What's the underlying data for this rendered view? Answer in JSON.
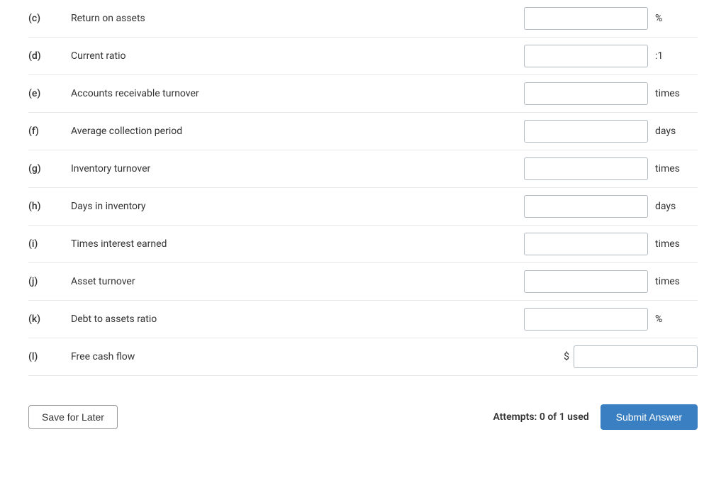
{
  "rows": [
    {
      "id": "c",
      "prefix": "(c)",
      "label": "Return on assets",
      "unit": "%",
      "hasDollar": false,
      "inputName": "return-on-assets-input"
    },
    {
      "id": "d",
      "prefix": "(d)",
      "label": "Current ratio",
      "unit": ":1",
      "hasDollar": false,
      "inputName": "current-ratio-input"
    },
    {
      "id": "e",
      "prefix": "(e)",
      "label": "Accounts receivable turnover",
      "unit": "times",
      "hasDollar": false,
      "inputName": "accounts-receivable-turnover-input"
    },
    {
      "id": "f",
      "prefix": "(f)",
      "label": "Average collection period",
      "unit": "days",
      "hasDollar": false,
      "inputName": "average-collection-period-input"
    },
    {
      "id": "g",
      "prefix": "(g)",
      "label": "Inventory turnover",
      "unit": "times",
      "hasDollar": false,
      "inputName": "inventory-turnover-input"
    },
    {
      "id": "h",
      "prefix": "(h)",
      "label": "Days in inventory",
      "unit": "days",
      "hasDollar": false,
      "inputName": "days-in-inventory-input"
    },
    {
      "id": "i",
      "prefix": "(i)",
      "label": "Times interest earned",
      "unit": "times",
      "hasDollar": false,
      "inputName": "times-interest-earned-input"
    },
    {
      "id": "j",
      "prefix": "(j)",
      "label": "Asset turnover",
      "unit": "times",
      "hasDollar": false,
      "inputName": "asset-turnover-input"
    },
    {
      "id": "k",
      "prefix": "(k)",
      "label": "Debt to assets ratio",
      "unit": "%",
      "hasDollar": false,
      "inputName": "debt-to-assets-input"
    },
    {
      "id": "l",
      "prefix": "(l)",
      "label": "Free cash flow",
      "unit": "",
      "hasDollar": true,
      "inputName": "free-cash-flow-input"
    }
  ],
  "footer": {
    "save_label": "Save for Later",
    "attempts_label": "Attempts: 0 of 1 used",
    "submit_label": "Submit Answer"
  }
}
